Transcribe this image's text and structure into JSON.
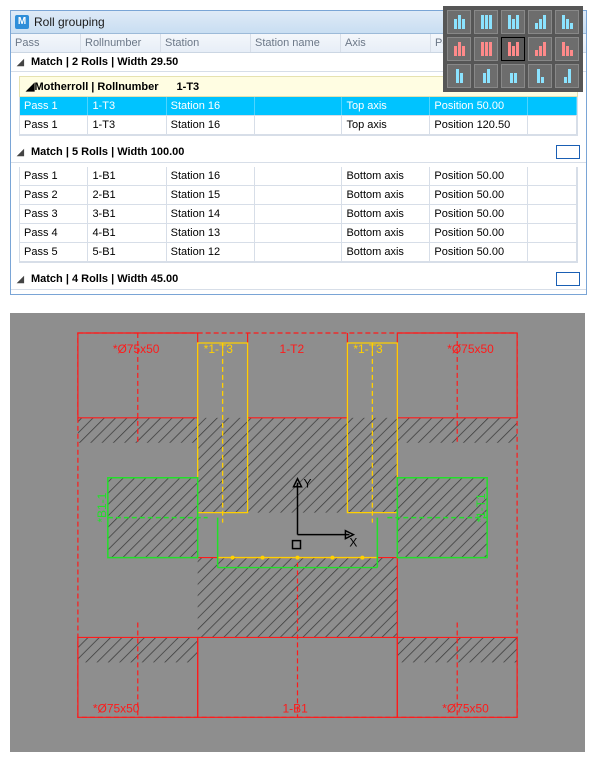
{
  "titlebar": {
    "appicon_letter": "M",
    "title": "Roll grouping"
  },
  "columns": {
    "pass": "Pass",
    "rollnumber": "Rollnumber",
    "station": "Station",
    "station_name": "Station name",
    "axis": "Axis",
    "position": "Position"
  },
  "group1": {
    "header": "Match | 2 Rolls | Width 29.50",
    "mother_label": "Motherroll | Rollnumber",
    "mother_value": "1-T3",
    "rows": [
      {
        "pass": "Pass 1",
        "rolln": "1-T3",
        "station": "Station 16",
        "stname": "",
        "axis": "Top axis",
        "pos": "Position 50.00"
      },
      {
        "pass": "Pass 1",
        "rolln": "1-T3",
        "station": "Station 16",
        "stname": "",
        "axis": "Top axis",
        "pos": "Position 120.50"
      }
    ]
  },
  "group2": {
    "header": "Match | 5 Rolls | Width 100.00",
    "rows": [
      {
        "pass": "Pass 1",
        "rolln": "1-B1",
        "station": "Station 16",
        "stname": "",
        "axis": "Bottom axis",
        "pos": "Position 50.00"
      },
      {
        "pass": "Pass 2",
        "rolln": "2-B1",
        "station": "Station 15",
        "stname": "",
        "axis": "Bottom axis",
        "pos": "Position 50.00"
      },
      {
        "pass": "Pass 3",
        "rolln": "3-B1",
        "station": "Station 14",
        "stname": "",
        "axis": "Bottom axis",
        "pos": "Position 50.00"
      },
      {
        "pass": "Pass 4",
        "rolln": "4-B1",
        "station": "Station 13",
        "stname": "",
        "axis": "Bottom axis",
        "pos": "Position 50.00"
      },
      {
        "pass": "Pass 5",
        "rolln": "5-B1",
        "station": "Station 12",
        "stname": "",
        "axis": "Bottom axis",
        "pos": "Position 50.00"
      }
    ]
  },
  "group3": {
    "header": "Match | 4 Rolls | Width 45.00"
  },
  "cad": {
    "labels": {
      "top_left_dim": "*Ø75x50",
      "top_right_dim": "*Ø75x50",
      "bottom_left_dim": "*Ø75x50",
      "bottom_right_dim": "*Ø75x50",
      "t3_left": "*1-T3",
      "t3_right": "*1-T3",
      "t2": "1-T2",
      "b1": "1-B1",
      "x": "X",
      "y": "Y",
      "green_left": "*B1-1",
      "green_right": "*1-T1"
    }
  }
}
